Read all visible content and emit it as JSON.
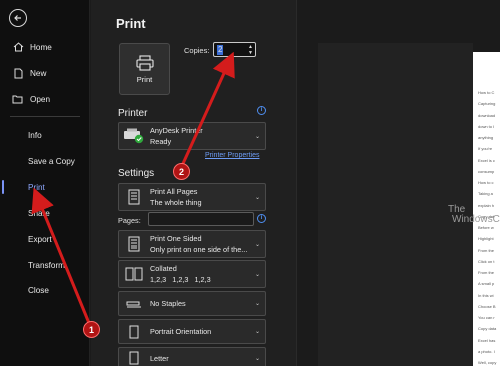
{
  "nav": {
    "items": [
      {
        "label": "Home",
        "icon": "home-icon"
      },
      {
        "label": "New",
        "icon": "new-document-icon"
      },
      {
        "label": "Open",
        "icon": "folder-open-icon"
      }
    ],
    "secondary": [
      "Info",
      "Save a Copy",
      "Print",
      "Share",
      "Export",
      "Transform",
      "Close"
    ],
    "active": "Print",
    "accent": "#8fa8ff"
  },
  "print": {
    "title": "Print",
    "button_label": "Print",
    "copies_label": "Copies:",
    "copies_value": "2",
    "printer_heading": "Printer",
    "printer_name": "AnyDesk Printer",
    "printer_status": "Ready",
    "printer_properties": "Printer Properties",
    "settings_heading": "Settings",
    "pages_label": "Pages:",
    "pages_value": "",
    "settings": [
      {
        "line1": "Print All Pages",
        "line2": "The whole thing",
        "icon": "document-pages-icon"
      },
      {
        "line1": "Print One Sided",
        "line2": "Only print on one side of the...",
        "icon": "one-sided-icon"
      },
      {
        "line1": "Collated",
        "line2": [
          "1,2,3",
          "1,2,3",
          "1,2,3"
        ],
        "icon": "collated-icon"
      },
      {
        "line1": "No Staples",
        "line2": "",
        "icon": "staple-icon"
      },
      {
        "line1": "Portrait Orientation",
        "line2": "",
        "icon": "portrait-icon"
      },
      {
        "line1": "Letter",
        "line2": "",
        "icon": "paper-size-icon"
      }
    ]
  },
  "preview": {
    "lines": [
      "How to C",
      "Capturing",
      "download",
      "down to I",
      "anything",
      "If you're",
      "Excel is c",
      "consump",
      "How to c",
      "Taking a",
      "explain h",
      "Copy dat",
      "Before w",
      "Highlight",
      "From the",
      "Click on t",
      "From the",
      "A small p",
      "In this wi",
      "Choose B",
      "You can r",
      "Copy data",
      "Excel has",
      "a photo. I",
      "Well, copy",
      "Return to"
    ],
    "watermark_line1": "The",
    "watermark_line2": "WindowsClub"
  },
  "annotations": {
    "badge1": "1",
    "badge2": "2",
    "color": "#c0161a"
  }
}
